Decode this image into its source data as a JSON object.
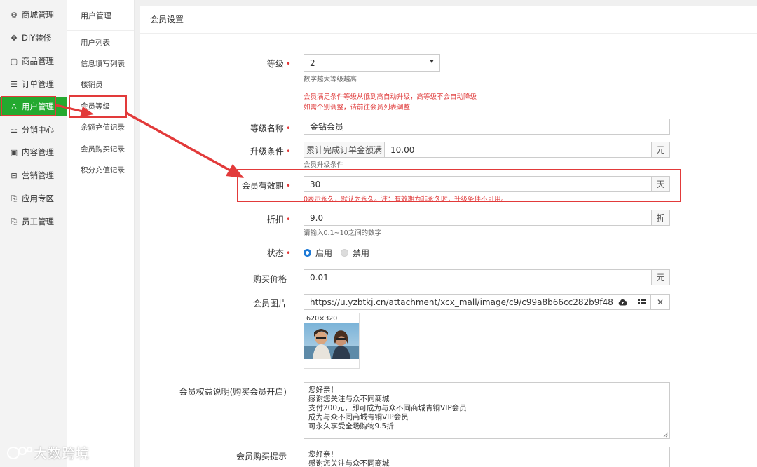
{
  "sidebar_primary": {
    "items": [
      {
        "label": "商城管理",
        "icon": "gear-icon"
      },
      {
        "label": "DIY装修",
        "icon": "diy-icon"
      },
      {
        "label": "商品管理",
        "icon": "bag-icon"
      },
      {
        "label": "订单管理",
        "icon": "order-icon"
      },
      {
        "label": "用户管理",
        "icon": "user-icon",
        "active": true
      },
      {
        "label": "分销中心",
        "icon": "network-icon"
      },
      {
        "label": "内容管理",
        "icon": "content-icon"
      },
      {
        "label": "营销管理",
        "icon": "marketing-icon"
      },
      {
        "label": "应用专区",
        "icon": "app-icon"
      },
      {
        "label": "员工管理",
        "icon": "staff-icon"
      }
    ],
    "active_color": "#24a92f"
  },
  "sidebar_secondary": {
    "title": "用户管理",
    "items": [
      {
        "label": "用户列表"
      },
      {
        "label": "信息填写列表"
      },
      {
        "label": "核销员"
      },
      {
        "label": "会员等级",
        "active": true
      },
      {
        "label": "余额充值记录"
      },
      {
        "label": "会员购买记录"
      },
      {
        "label": "积分充值记录"
      }
    ]
  },
  "main": {
    "title": "会员设置",
    "level": {
      "label": "等级",
      "value": "2",
      "hint": "数字越大等级越高",
      "warning_1": "会员满足条件等级从低到高自动升级，高等级不会自动降级",
      "warning_2": "如需个别调整，请前往会员列表调整"
    },
    "level_name": {
      "label": "等级名称",
      "value": "金钻会员"
    },
    "upgrade": {
      "label": "升级条件",
      "condition": "累计完成订单金额满",
      "value": "10.00",
      "unit": "元",
      "hint": "会员升级条件"
    },
    "validity": {
      "label": "会员有效期",
      "value": "30",
      "unit": "天",
      "hint": "0表示永久，默认为永久。注：有效期为非永久时，升级条件不可用。"
    },
    "discount": {
      "label": "折扣",
      "value": "9.0",
      "unit": "折",
      "hint": "请输入0.1~10之间的数字"
    },
    "status": {
      "label": "状态",
      "option_on": "启用",
      "option_off": "禁用",
      "selected": "启用"
    },
    "price": {
      "label": "购买价格",
      "value": "0.01",
      "unit": "元"
    },
    "image": {
      "label": "会员图片",
      "value": "https://u.yzbtkj.cn/attachment/xcx_mall/image/c9/c99a8b66cc282b9f480262f46",
      "size_label": "620×320"
    },
    "benefits": {
      "label": "会员权益说明(购买会员开启)",
      "lines": [
        "您好亲！",
        "感谢您关注与众不同商城",
        "支付200元，即可成为与众不同商城青铜VIP会员",
        "成为与众不同商城青铜VIP会员",
        "可永久享受全场购物9.5折"
      ]
    },
    "purchase_tip": {
      "label": "会员购买提示",
      "lines": [
        "您好亲！",
        "感谢您关注与众不同商城"
      ]
    }
  },
  "watermark": "大数跨境",
  "accent_colors": {
    "required": "#e23a3a",
    "radio": "#1e7ad6",
    "annotation": "#e23a3a"
  }
}
